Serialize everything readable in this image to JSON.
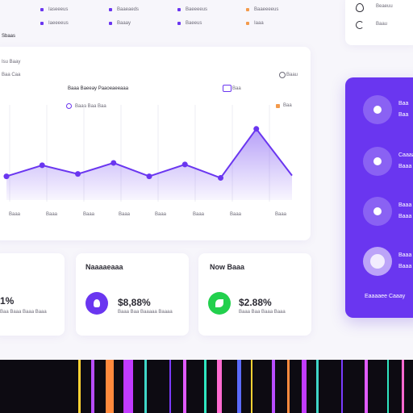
{
  "legend": [
    {
      "label": "Iaseeeus",
      "color": "#6a36f0"
    },
    {
      "label": "Baaeaeds",
      "color": "#6a36f0"
    },
    {
      "label": "Baeeeeus",
      "color": "#6a36f0"
    },
    {
      "label": "Baaeeeeus",
      "color": "#f39a4b"
    }
  ],
  "legend_row2": [
    {
      "label": "Iaeeeeus",
      "color": "#6a36f0"
    },
    {
      "label": "Baaay",
      "color": "#6a36f0"
    },
    {
      "label": "Baeeus",
      "color": "#6a36f0"
    },
    {
      "label": "Iaaa",
      "color": "#f39a4b"
    }
  ],
  "header": {
    "left_label": "Sbaas",
    "sub_label_1": "Isu Baay",
    "sub_label_2": "Baa Caa"
  },
  "top_right": {
    "item1": "Beaeuu",
    "item2": "Baau"
  },
  "chart_card": {
    "title": "Baaa Baeeay Paaoeaeeaaa",
    "toggle_label": "Baa",
    "series_label": "Baaa Baa Baa",
    "right_label": "Baa"
  },
  "chart_data": {
    "type": "area",
    "categories": [
      "Baaa",
      "Baaa",
      "Baaa",
      "Baaa",
      "Baaa",
      "Baaa",
      "Baaa",
      "Baaa"
    ],
    "series": [
      {
        "name": "Baaa Baa Baa",
        "values": [
          30,
          44,
          33,
          47,
          30,
          45,
          28,
          90,
          31
        ]
      }
    ],
    "color": "#6a36f0"
  },
  "side_panel": {
    "items": [
      {
        "label1": "Baa",
        "label2": "Baa"
      },
      {
        "label1": "Caaaa",
        "label2": "Baaa"
      },
      {
        "label1": "Baaa",
        "label2": "Baaa"
      },
      {
        "label1": "Baaa",
        "label2": "Baaa"
      }
    ],
    "footer": "Eaaaaee Caaay"
  },
  "stat_cards": [
    {
      "title": "",
      "value": "1%",
      "caption": "Baa Baaa Baaa Baaa"
    },
    {
      "title": "Naaaaeaaa",
      "value": "$8,88%",
      "caption": "Baaa Baa Baaaaa Baaaa",
      "icon_color": "#6a36f0"
    },
    {
      "title": "Now Baaa",
      "value": "$2.88%",
      "caption": "Baaa Baa Baaa Baaa",
      "icon_color": "#22d04d"
    }
  ],
  "strip_colors": [
    "#ffd233",
    "#b94dff",
    "#ff8a3d",
    "#c13bff",
    "#3fd6c8",
    "#7a3bff",
    "#e05bff",
    "#2fe6c0",
    "#ff6ad0",
    "#5b6bff"
  ]
}
